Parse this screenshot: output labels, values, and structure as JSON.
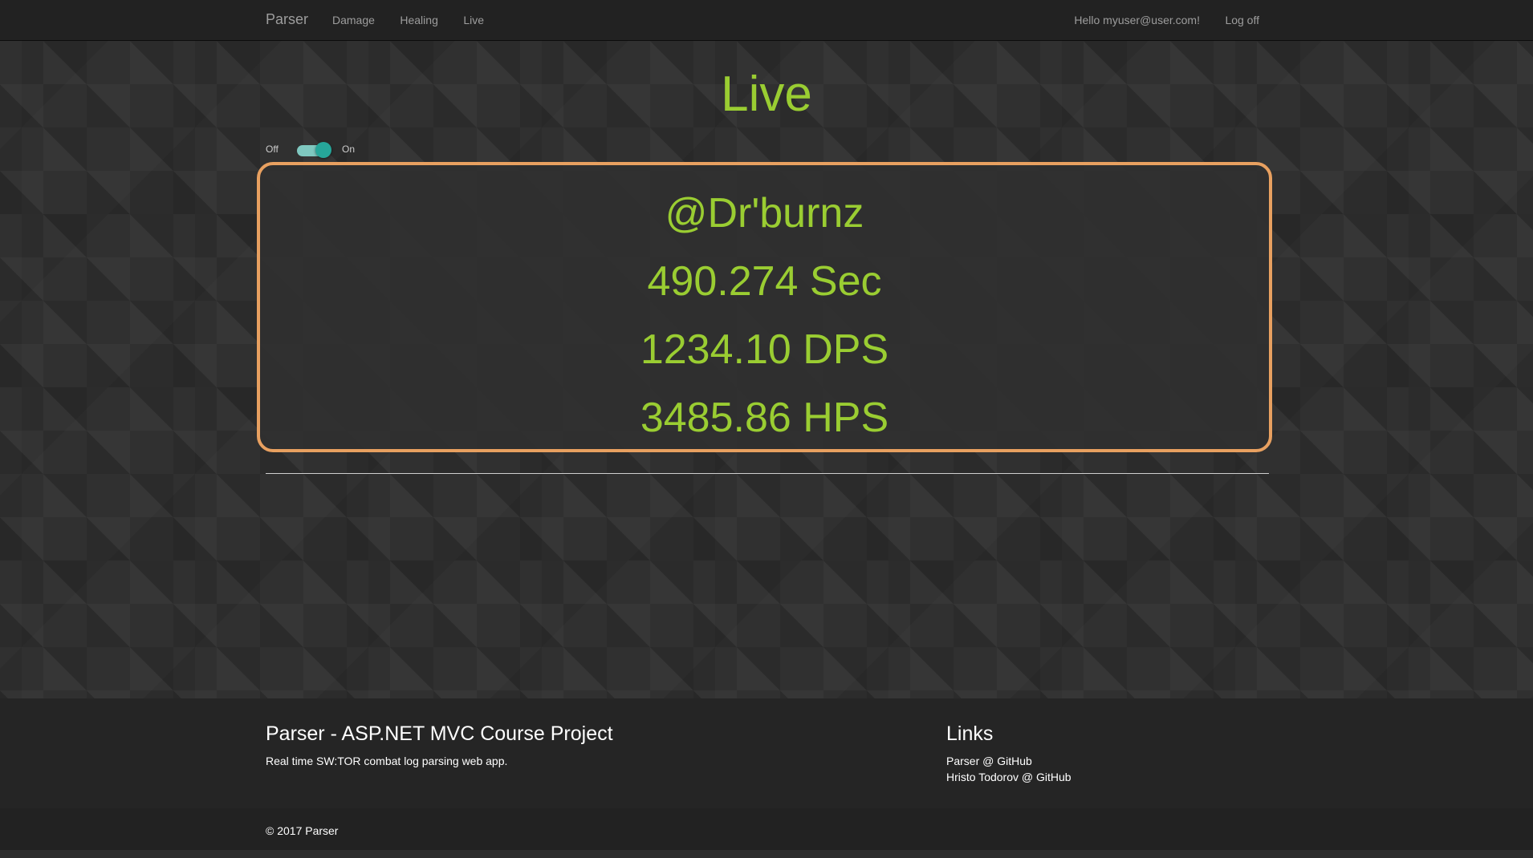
{
  "nav": {
    "brand": "Parser",
    "links": [
      "Damage",
      "Healing",
      "Live"
    ],
    "greeting": "Hello myuser@user.com!",
    "logoff": "Log off"
  },
  "page": {
    "title": "Live"
  },
  "toggle": {
    "off_label": "Off",
    "on_label": "On",
    "state": "on"
  },
  "live": {
    "player": "@Dr'burnz",
    "time": "490.274 Sec",
    "dps": "1234.10 DPS",
    "hps": "3485.86 HPS"
  },
  "footer": {
    "title": "Parser - ASP.NET MVC Course Project",
    "description": "Real time SW:TOR combat log parsing web app.",
    "links_title": "Links",
    "links": [
      "Parser @ GitHub",
      "Hristo Todorov @ GitHub"
    ],
    "copyright": "© 2017 Parser"
  },
  "colors": {
    "accent_green": "#9acd32",
    "box_border": "#e8a060",
    "toggle": "#26a69a"
  }
}
